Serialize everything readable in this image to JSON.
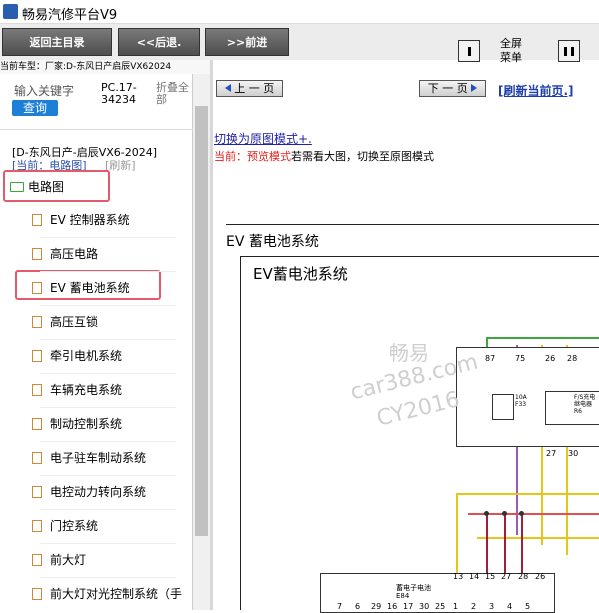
{
  "window": {
    "title": "畅易汽修平台V9"
  },
  "toolbar": {
    "home_label": "返回主目录",
    "back_label": "<<后退.",
    "forward_label": ">>前进",
    "fullscreen_line1": "全屏",
    "fullscreen_line2": "菜单"
  },
  "cartype": "当前车型：厂家:D-东风日产启辰VX62024",
  "search": {
    "label": "输入关键字",
    "button": "查询"
  },
  "doc": {
    "pc_line1": "PC.17-",
    "pc_line2": "34234",
    "fold_line1": "折叠全",
    "fold_line2": "部"
  },
  "tree": {
    "vehicle": "[D-东风日产-启辰VX6-2024]",
    "current": "[当前：电路图]",
    "refresh": "[刷新]",
    "root": "电路图",
    "items": [
      {
        "label": "EV 控制器系统"
      },
      {
        "label": "高压电路"
      },
      {
        "label": "EV 蓄电池系统"
      },
      {
        "label": "高压互锁"
      },
      {
        "label": "牵引电机系统"
      },
      {
        "label": "车辆充电系统"
      },
      {
        "label": "制动控制系统"
      },
      {
        "label": "电子驻车制动系统"
      },
      {
        "label": "电控动力转向系统"
      },
      {
        "label": "门控系统"
      },
      {
        "label": "前大灯"
      },
      {
        "label": "前大灯对光控制系统（手"
      }
    ]
  },
  "viewer": {
    "prev_label": "上 一 页",
    "next_label": "下 一 页",
    "refresh_label": "[刷新当前页.]",
    "switch_label": "切换为原图模式+.",
    "mode_current": "当前：预览模式",
    "mode_hint": "若需看大图，切换至原图模式",
    "page_title": "EV 蓄电池系统",
    "diagram_title": "EV蓄电池系统",
    "watermark": [
      "畅易",
      "car388.com",
      "CY2016"
    ],
    "fuse_pins": [
      "87",
      "75",
      "26",
      "28"
    ],
    "fuse_label": "10A\nF33",
    "relay_label": "F/S充电\n继电器\nR6",
    "relay_pins": [
      "27",
      "30"
    ],
    "connector_label": "蓄电子电池\nE84",
    "conn_top_pins": [
      "13",
      "14",
      "15",
      "27",
      "28",
      "26"
    ],
    "conn_bottom_pins": [
      "7",
      "6",
      "29",
      "16",
      "17",
      "30",
      "25",
      "1",
      "2",
      "3",
      "4",
      "5"
    ]
  }
}
